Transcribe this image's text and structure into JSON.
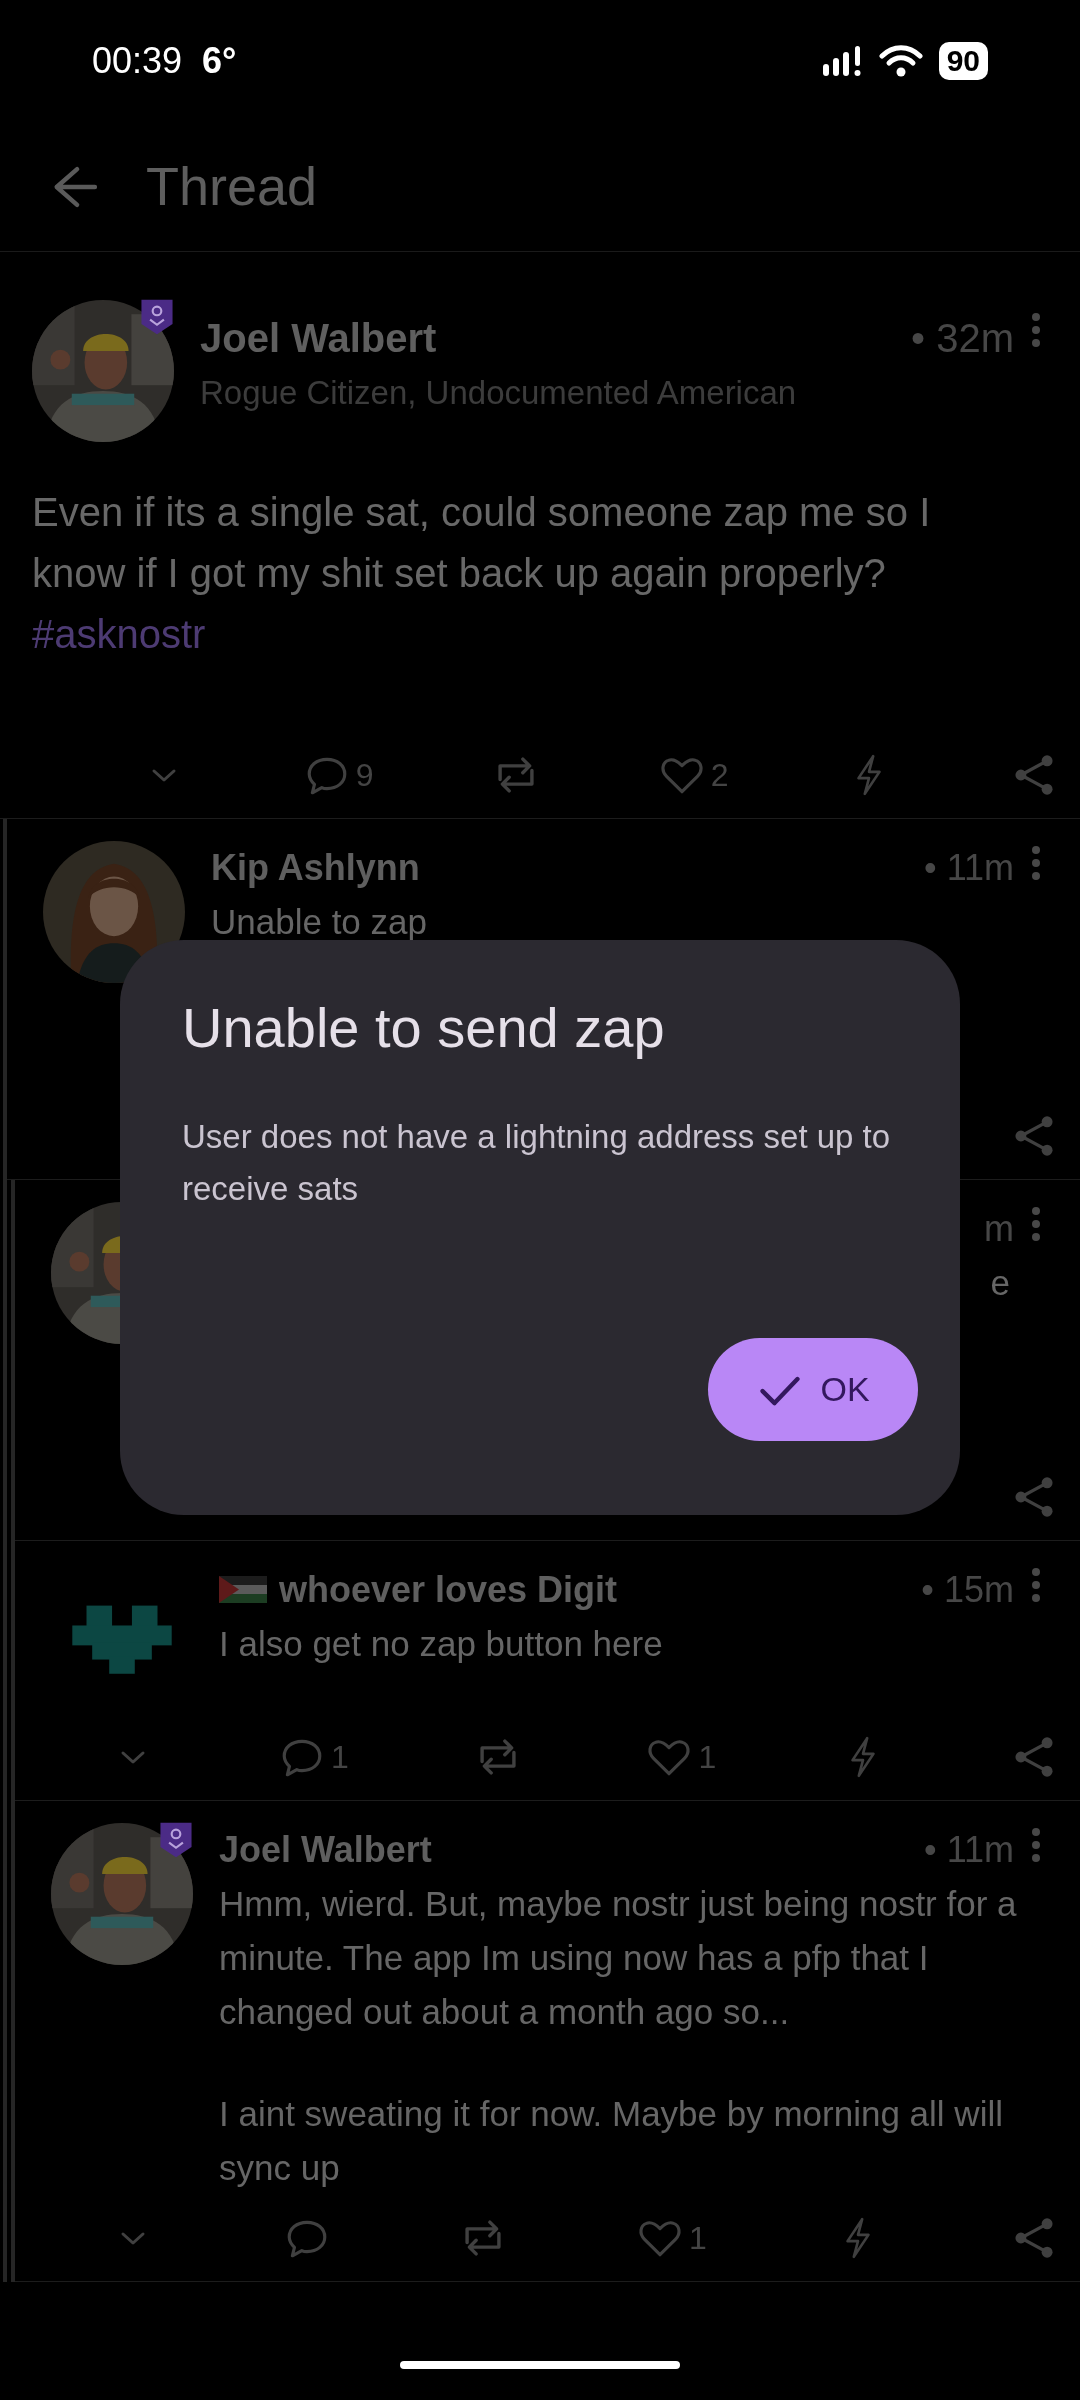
{
  "status_bar": {
    "time": "00:39",
    "temperature": "6°",
    "battery": "90"
  },
  "header": {
    "title": "Thread"
  },
  "post": {
    "author": "Joel Walbert",
    "badge": true,
    "subtitle": "Rogue Citizen, Undocumented American",
    "time": "• 32m",
    "body": [
      "Even if its a single sat, could someone zap me so I know if I got my shit set back up again properly?"
    ],
    "hashtag": "#asknostr",
    "actions": {
      "kind": "full",
      "comments": "9",
      "likes": "2"
    }
  },
  "replies": [
    {
      "author": "Kip Ashlynn",
      "badge": false,
      "flag": false,
      "time": "• 11m",
      "body": [
        "Unable to zap"
      ],
      "actions": {
        "kind": "share"
      },
      "children": [
        {
          "time": "m",
          "badge": false,
          "flag": false,
          "body": [
            "e"
          ],
          "actions": {
            "kind": "share"
          }
        },
        {
          "author": "whoever loves Digit",
          "badge": false,
          "flag": true,
          "time": "• 15m",
          "body": [
            "I also get no zap button here"
          ],
          "actions": {
            "kind": "full",
            "comments": "1",
            "likes": "1"
          }
        },
        {
          "author": "Joel Walbert",
          "badge": true,
          "flag": false,
          "time": "• 11m",
          "body": [
            "Hmm, wierd. But, maybe nostr just being nostr for a minute. The app Im using now has a pfp that I changed out about a month ago so...",
            "I aint sweating it for now. Maybe by morning all will sync up"
          ],
          "actions": {
            "kind": "full",
            "likes": "1"
          }
        }
      ]
    }
  ],
  "dialog": {
    "title": "Unable to send zap",
    "message": "User does not have a lightning address set up to receive sats",
    "button": "OK"
  }
}
